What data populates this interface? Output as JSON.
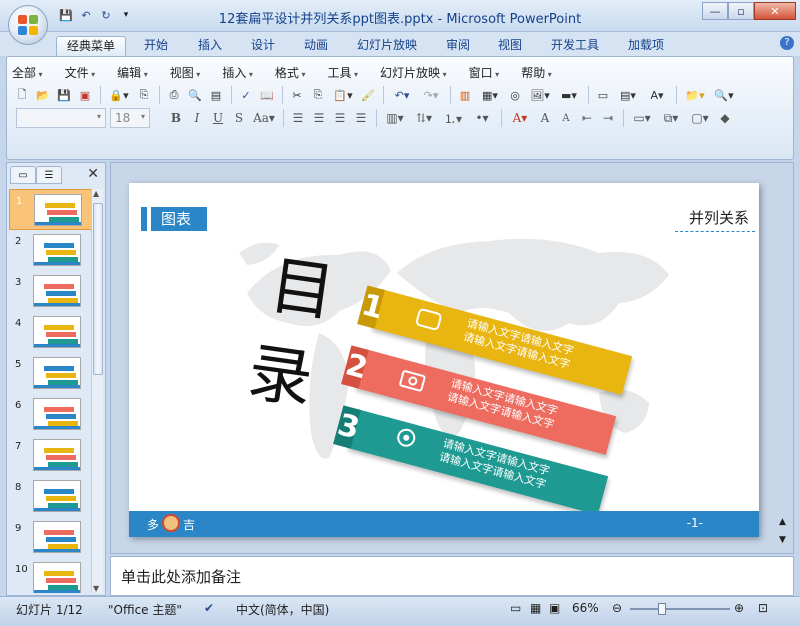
{
  "window": {
    "title": "12套扁平设计并列关系ppt图表.pptx - Microsoft PowerPoint"
  },
  "ribbon_tabs": [
    "经典菜单",
    "开始",
    "插入",
    "设计",
    "动画",
    "幻灯片放映",
    "审阅",
    "视图",
    "开发工具",
    "加载项"
  ],
  "menus": [
    "全部",
    "文件",
    "编辑",
    "视图",
    "插入",
    "格式",
    "工具",
    "幻灯片放映",
    "窗口",
    "帮助"
  ],
  "font": {
    "size": "18"
  },
  "thumbnails": [
    "1",
    "2",
    "3",
    "4",
    "5",
    "6",
    "7",
    "8",
    "9",
    "10"
  ],
  "slide": {
    "header_tag": "图表",
    "header_right": "并列关系",
    "title_chars": [
      "目",
      "录"
    ],
    "items": [
      {
        "line1": "请输入文字请输入文字",
        "line2": "请输入文字请输入文字",
        "color": "#e8b511",
        "icon": "chat-bubble-icon",
        "number": "1"
      },
      {
        "line1": "请输入文字请输入文字",
        "line2": "请输入文字请输入文字",
        "color": "#ee6c5f",
        "icon": "camera-icon",
        "number": "2"
      },
      {
        "line1": "请输入文字请输入文字",
        "line2": "请输入文字请输入文字",
        "color": "#1e9a93",
        "icon": "webcam-icon",
        "number": "3"
      }
    ],
    "footer_left_a": "多",
    "footer_left_b": "吉",
    "footer_page": "-1-",
    "accent": "#2a86c6"
  },
  "notes": {
    "placeholder": "单击此处添加备注"
  },
  "status": {
    "slide": "幻灯片 1/12",
    "theme": "\"Office 主题\"",
    "language": "中文(简体，中国)",
    "zoom": "66%"
  }
}
